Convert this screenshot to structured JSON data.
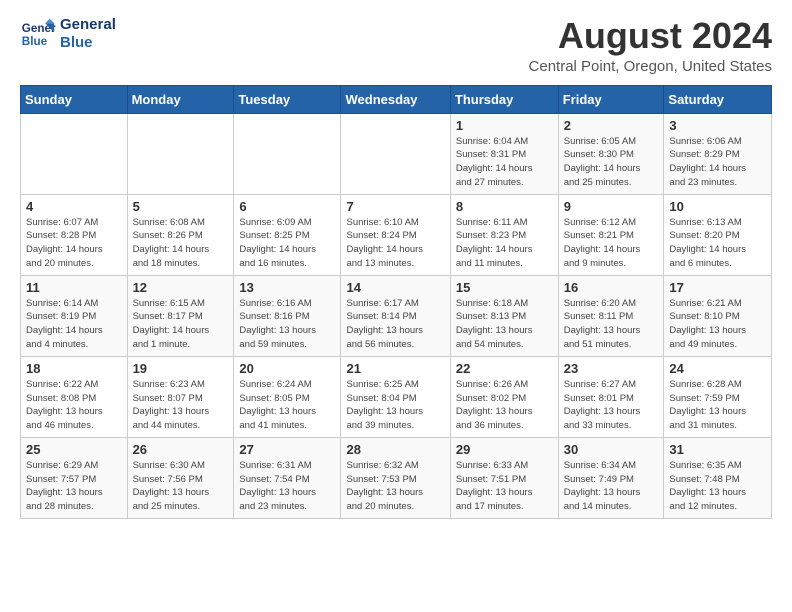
{
  "logo": {
    "line1": "General",
    "line2": "Blue"
  },
  "title": "August 2024",
  "location": "Central Point, Oregon, United States",
  "weekdays": [
    "Sunday",
    "Monday",
    "Tuesday",
    "Wednesday",
    "Thursday",
    "Friday",
    "Saturday"
  ],
  "weeks": [
    [
      {
        "day": "",
        "info": ""
      },
      {
        "day": "",
        "info": ""
      },
      {
        "day": "",
        "info": ""
      },
      {
        "day": "",
        "info": ""
      },
      {
        "day": "1",
        "info": "Sunrise: 6:04 AM\nSunset: 8:31 PM\nDaylight: 14 hours\nand 27 minutes."
      },
      {
        "day": "2",
        "info": "Sunrise: 6:05 AM\nSunset: 8:30 PM\nDaylight: 14 hours\nand 25 minutes."
      },
      {
        "day": "3",
        "info": "Sunrise: 6:06 AM\nSunset: 8:29 PM\nDaylight: 14 hours\nand 23 minutes."
      }
    ],
    [
      {
        "day": "4",
        "info": "Sunrise: 6:07 AM\nSunset: 8:28 PM\nDaylight: 14 hours\nand 20 minutes."
      },
      {
        "day": "5",
        "info": "Sunrise: 6:08 AM\nSunset: 8:26 PM\nDaylight: 14 hours\nand 18 minutes."
      },
      {
        "day": "6",
        "info": "Sunrise: 6:09 AM\nSunset: 8:25 PM\nDaylight: 14 hours\nand 16 minutes."
      },
      {
        "day": "7",
        "info": "Sunrise: 6:10 AM\nSunset: 8:24 PM\nDaylight: 14 hours\nand 13 minutes."
      },
      {
        "day": "8",
        "info": "Sunrise: 6:11 AM\nSunset: 8:23 PM\nDaylight: 14 hours\nand 11 minutes."
      },
      {
        "day": "9",
        "info": "Sunrise: 6:12 AM\nSunset: 8:21 PM\nDaylight: 14 hours\nand 9 minutes."
      },
      {
        "day": "10",
        "info": "Sunrise: 6:13 AM\nSunset: 8:20 PM\nDaylight: 14 hours\nand 6 minutes."
      }
    ],
    [
      {
        "day": "11",
        "info": "Sunrise: 6:14 AM\nSunset: 8:19 PM\nDaylight: 14 hours\nand 4 minutes."
      },
      {
        "day": "12",
        "info": "Sunrise: 6:15 AM\nSunset: 8:17 PM\nDaylight: 14 hours\nand 1 minute."
      },
      {
        "day": "13",
        "info": "Sunrise: 6:16 AM\nSunset: 8:16 PM\nDaylight: 13 hours\nand 59 minutes."
      },
      {
        "day": "14",
        "info": "Sunrise: 6:17 AM\nSunset: 8:14 PM\nDaylight: 13 hours\nand 56 minutes."
      },
      {
        "day": "15",
        "info": "Sunrise: 6:18 AM\nSunset: 8:13 PM\nDaylight: 13 hours\nand 54 minutes."
      },
      {
        "day": "16",
        "info": "Sunrise: 6:20 AM\nSunset: 8:11 PM\nDaylight: 13 hours\nand 51 minutes."
      },
      {
        "day": "17",
        "info": "Sunrise: 6:21 AM\nSunset: 8:10 PM\nDaylight: 13 hours\nand 49 minutes."
      }
    ],
    [
      {
        "day": "18",
        "info": "Sunrise: 6:22 AM\nSunset: 8:08 PM\nDaylight: 13 hours\nand 46 minutes."
      },
      {
        "day": "19",
        "info": "Sunrise: 6:23 AM\nSunset: 8:07 PM\nDaylight: 13 hours\nand 44 minutes."
      },
      {
        "day": "20",
        "info": "Sunrise: 6:24 AM\nSunset: 8:05 PM\nDaylight: 13 hours\nand 41 minutes."
      },
      {
        "day": "21",
        "info": "Sunrise: 6:25 AM\nSunset: 8:04 PM\nDaylight: 13 hours\nand 39 minutes."
      },
      {
        "day": "22",
        "info": "Sunrise: 6:26 AM\nSunset: 8:02 PM\nDaylight: 13 hours\nand 36 minutes."
      },
      {
        "day": "23",
        "info": "Sunrise: 6:27 AM\nSunset: 8:01 PM\nDaylight: 13 hours\nand 33 minutes."
      },
      {
        "day": "24",
        "info": "Sunrise: 6:28 AM\nSunset: 7:59 PM\nDaylight: 13 hours\nand 31 minutes."
      }
    ],
    [
      {
        "day": "25",
        "info": "Sunrise: 6:29 AM\nSunset: 7:57 PM\nDaylight: 13 hours\nand 28 minutes."
      },
      {
        "day": "26",
        "info": "Sunrise: 6:30 AM\nSunset: 7:56 PM\nDaylight: 13 hours\nand 25 minutes."
      },
      {
        "day": "27",
        "info": "Sunrise: 6:31 AM\nSunset: 7:54 PM\nDaylight: 13 hours\nand 23 minutes."
      },
      {
        "day": "28",
        "info": "Sunrise: 6:32 AM\nSunset: 7:53 PM\nDaylight: 13 hours\nand 20 minutes."
      },
      {
        "day": "29",
        "info": "Sunrise: 6:33 AM\nSunset: 7:51 PM\nDaylight: 13 hours\nand 17 minutes."
      },
      {
        "day": "30",
        "info": "Sunrise: 6:34 AM\nSunset: 7:49 PM\nDaylight: 13 hours\nand 14 minutes."
      },
      {
        "day": "31",
        "info": "Sunrise: 6:35 AM\nSunset: 7:48 PM\nDaylight: 13 hours\nand 12 minutes."
      }
    ]
  ]
}
